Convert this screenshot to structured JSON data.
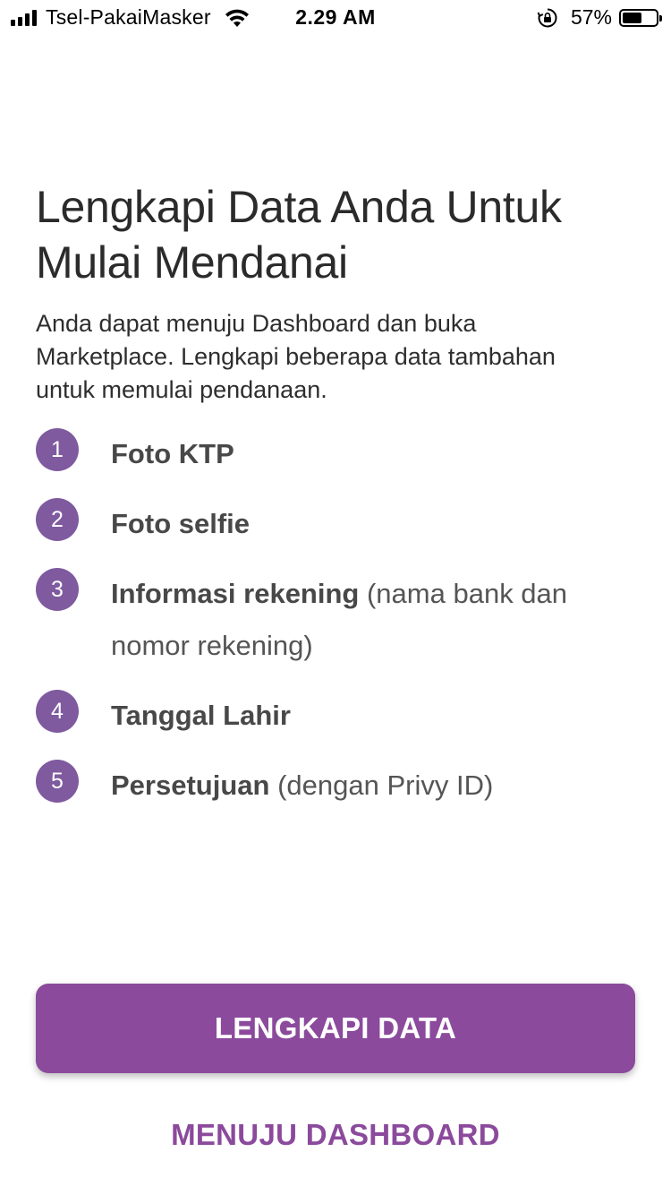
{
  "status_bar": {
    "carrier": "Tsel-PakaiMasker",
    "time": "2.29 AM",
    "battery_percent": "57%",
    "battery_level": 0.57,
    "icons": [
      "signal-icon",
      "wifi-icon",
      "rotation-lock-icon",
      "battery-icon"
    ]
  },
  "onboarding": {
    "title": "Lengkapi Data Anda Untuk Mulai Mendanai",
    "description": "Anda dapat menuju Dashboard dan buka Marketplace. Lengkapi beberapa data tambahan untuk memulai pendanaan.",
    "steps": [
      {
        "number": "1",
        "title": "Foto KTP",
        "note": ""
      },
      {
        "number": "2",
        "title": "Foto selfie",
        "note": ""
      },
      {
        "number": "3",
        "title": "Informasi rekening",
        "note": "(nama bank dan nomor rekening)"
      },
      {
        "number": "4",
        "title": "Tanggal Lahir",
        "note": ""
      },
      {
        "number": "5",
        "title": "Persetujuan",
        "note": "(dengan Privy ID)"
      }
    ]
  },
  "actions": {
    "primary_label": "LENGKAPI DATA",
    "secondary_label": "MENUJU DASHBOARD"
  },
  "colors": {
    "accent": "#8b4a9c",
    "step_badge": "#7f5a9f",
    "text": "#3d3d3d"
  }
}
